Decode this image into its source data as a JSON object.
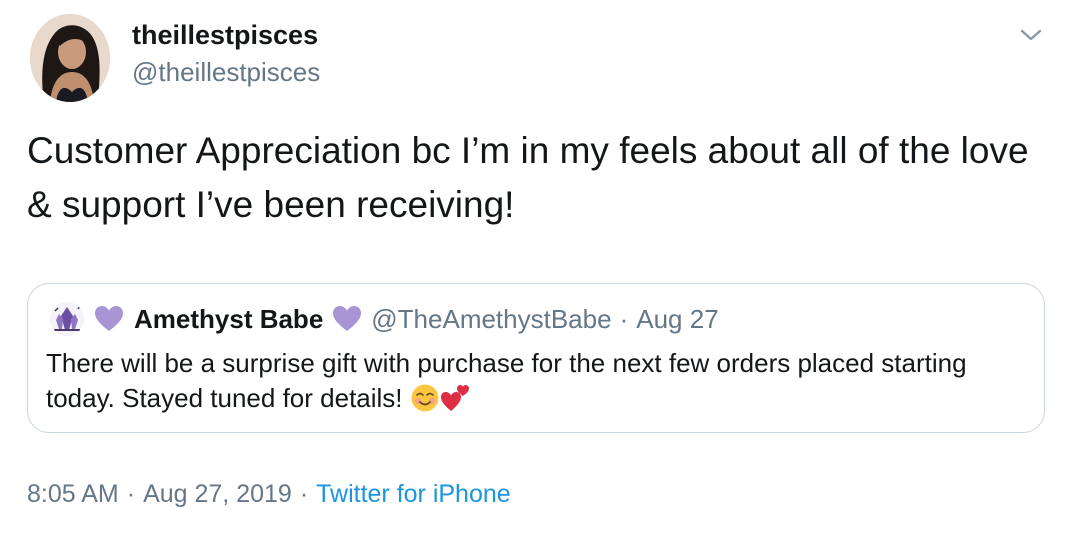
{
  "author": {
    "name": "theillestpisces",
    "handle": "@theillestpisces"
  },
  "tweet": {
    "text": "Customer Appreciation bc I’m in my feels about all of the love & support I’ve been receiving!"
  },
  "quoted_tweet": {
    "name": "Amethyst Babe",
    "handle": "@TheAmethystBabe",
    "separator": "·",
    "date": "Aug 27",
    "text": "There will be a surprise gift with purchase for the next few orders placed starting today. Stayed tuned for details!",
    "emojis": [
      "smiling-face-with-blush-icon",
      "two-hearts-icon"
    ],
    "heart_color": "#a995d4"
  },
  "meta": {
    "time": "8:05 AM",
    "separator": "·",
    "date": "Aug 27, 2019",
    "source": "Twitter for iPhone",
    "source_color": "#1b95e0"
  },
  "colors": {
    "text": "#14171a",
    "secondary": "#657786",
    "border": "#ccd6dd"
  },
  "icons": {
    "caret": "chevron-down-icon",
    "avatar": "avatar",
    "quoted_avatar": "crystal-logo-icon"
  }
}
